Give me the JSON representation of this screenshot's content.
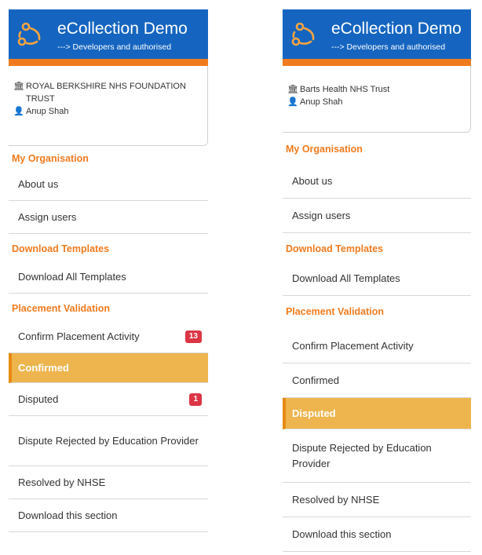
{
  "panels": [
    {
      "brand": {
        "title": "eCollection Demo",
        "subtitle": "---> Developers and authorised"
      },
      "user": {
        "organisation": "ROYAL BERKSHIRE NHS FOUNDATION TRUST",
        "name": "Anup Shah"
      },
      "sections": {
        "my_org": "My Organisation",
        "templates": "Download Templates",
        "validation": "Placement Validation"
      },
      "items": {
        "about": "About us",
        "assign": "Assign users",
        "download_all": "Download All Templates",
        "confirm": "Confirm Placement Activity",
        "confirm_badge": "13",
        "confirmed": "Confirmed",
        "disputed": "Disputed",
        "disputed_badge": "1",
        "rejected": "Dispute Rejected by Education Provider",
        "resolved": "Resolved by NHSE",
        "download_section": "Download this section"
      },
      "active_item": "Confirmed"
    },
    {
      "brand": {
        "title": "eCollection Demo",
        "subtitle": "---> Developers and authorised"
      },
      "user": {
        "organisation": "Barts Health NHS Trust",
        "name": "Anup Shah"
      },
      "sections": {
        "my_org": "My Organisation",
        "templates": "Download Templates",
        "validation": "Placement Validation"
      },
      "items": {
        "about": "About us",
        "assign": "Assign users",
        "download_all": "Download All Templates",
        "confirm": "Confirm Placement Activity",
        "confirmed": "Confirmed",
        "disputed": "Disputed",
        "rejected": "Dispute Rejected by Education Provider",
        "resolved": "Resolved by NHSE",
        "download_section": "Download this section"
      },
      "active_item": "Disputed"
    }
  ],
  "icons": {
    "logo": "ecollection-logo-icon",
    "org": "bank-building-icon",
    "user": "user-icon"
  },
  "colors": {
    "brand_blue": "#1565c0",
    "accent_orange": "#f07b1e",
    "active_bg": "#eeb54e",
    "badge_red": "#dc3545"
  }
}
